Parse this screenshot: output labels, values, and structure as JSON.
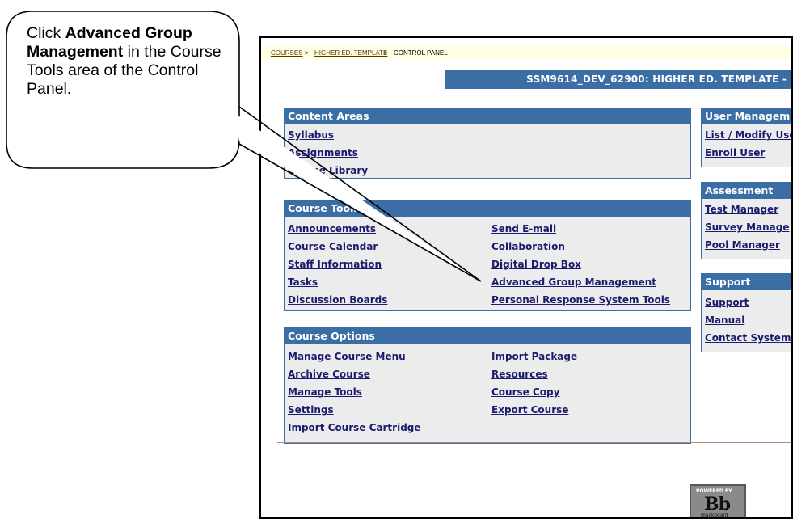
{
  "callout": {
    "text_before": "Click ",
    "text_bold": "Advanced Group Management",
    "text_after": " in the Course Tools area of the Control Panel."
  },
  "breadcrumb": {
    "courses": "COURSES",
    "sep1": " > ",
    "template": "HIGHER ED. TEMPLATE",
    "sep2": " > ",
    "current": "CONTROL PANEL"
  },
  "title": "SSM9614_DEV_62900: HIGHER ED. TEMPLATE -",
  "content_areas": {
    "heading": "Content Areas",
    "items": [
      "Syllabus",
      "Assignments",
      "Course Library"
    ]
  },
  "course_tools": {
    "heading": "Course Tools",
    "col1": [
      "Announcements",
      "Course Calendar",
      "Staff Information",
      "Tasks",
      "Discussion Boards"
    ],
    "col2": [
      "Send E-mail",
      "Collaboration",
      "Digital Drop Box",
      "Advanced Group Management",
      "Personal Response System Tools"
    ]
  },
  "course_options": {
    "heading": "Course Options",
    "col1": [
      "Manage Course Menu",
      "Archive Course",
      "Manage Tools",
      "Settings",
      "Import Course Cartridge"
    ],
    "col2": [
      "Import Package",
      "Resources",
      "Course Copy",
      "Export Course"
    ]
  },
  "user_management": {
    "heading": "User Managem",
    "items": [
      "List / Modify Use",
      "Enroll User"
    ]
  },
  "assessment": {
    "heading": "Assessment",
    "items": [
      "Test Manager",
      "Survey Manage",
      "Pool Manager"
    ]
  },
  "support": {
    "heading": "Support",
    "items": [
      "Support",
      "Manual",
      "Contact System"
    ]
  },
  "logo": {
    "powered_by": "POWERED BY",
    "mark": "Bb",
    "name": "Blackboard"
  },
  "colors": {
    "header_blue": "#3b6ea5",
    "panel_bg": "#ececec",
    "link": "#1b1b6e"
  }
}
